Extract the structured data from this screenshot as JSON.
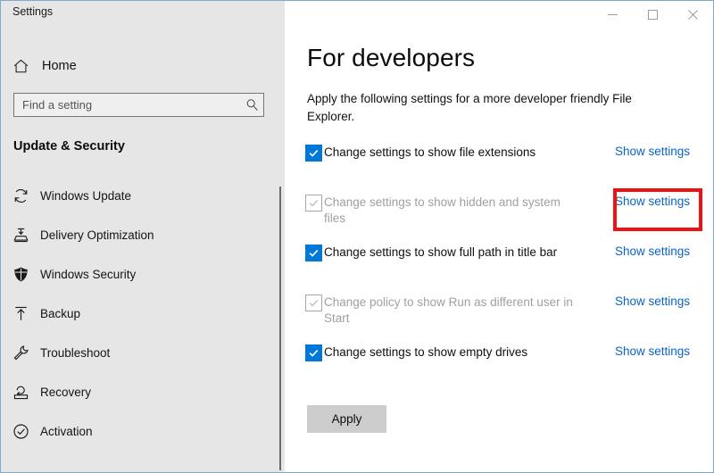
{
  "window": {
    "title": "Settings",
    "border_color": "#7fa8c9",
    "caption_buttons": [
      {
        "name": "minimize",
        "glyph": "minimize-icon",
        "label": "Minimize"
      },
      {
        "name": "maximize",
        "glyph": "maximize-icon",
        "label": "Maximize"
      },
      {
        "name": "close",
        "glyph": "close-icon",
        "label": "Close"
      }
    ]
  },
  "sidebar": {
    "background_color": "#e6e6e6",
    "home": {
      "label": "Home",
      "icon": "home-icon"
    },
    "search": {
      "value": "",
      "placeholder": "Find a setting",
      "icon": "search-icon"
    },
    "section_heading": "Update & Security",
    "items": [
      {
        "label": "Windows Update",
        "icon": "sync-icon"
      },
      {
        "label": "Delivery Optimization",
        "icon": "delivery-optimization-icon"
      },
      {
        "label": "Windows Security",
        "icon": "shield-icon"
      },
      {
        "label": "Backup",
        "icon": "upload-arrow-icon"
      },
      {
        "label": "Troubleshoot",
        "icon": "wrench-icon"
      },
      {
        "label": "Recovery",
        "icon": "recovery-icon"
      },
      {
        "label": "Activation",
        "icon": "check-circle-icon"
      }
    ]
  },
  "main": {
    "title": "For developers",
    "description": "Apply the following settings for a more developer friendly File Explorer.",
    "accent_color": "#0078d7",
    "link_color": "#0a64c2",
    "settings": [
      {
        "label": "Change settings to show file extensions",
        "checked": true,
        "disabled": false,
        "link_label": "Show settings"
      },
      {
        "label": "Change settings to show hidden and system files",
        "checked": false,
        "disabled": true,
        "link_label": "Show settings"
      },
      {
        "label": "Change settings to show full path in title bar",
        "checked": true,
        "disabled": false,
        "link_label": "Show settings"
      },
      {
        "label": "Change policy to show Run as different user in Start",
        "checked": false,
        "disabled": true,
        "link_label": "Show settings"
      },
      {
        "label": "Change settings to show empty drives",
        "checked": true,
        "disabled": false,
        "link_label": "Show settings"
      }
    ],
    "apply_label": "Apply"
  },
  "annotation": {
    "highlight_color": "#ee1111",
    "target": "Show settings link on row 2"
  }
}
